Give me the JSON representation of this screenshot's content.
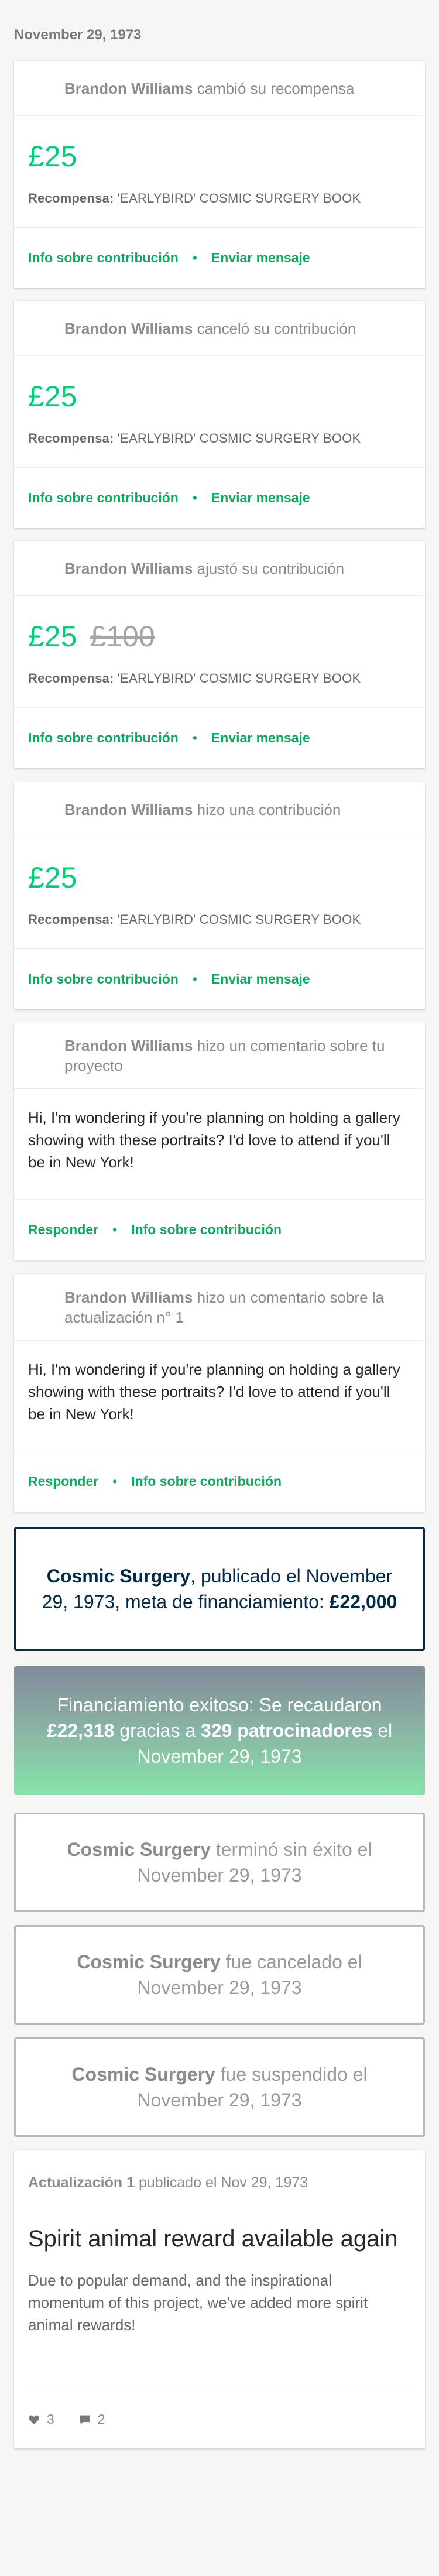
{
  "date_header": "November 29, 1973",
  "activity_cards": [
    {
      "user": "Brandon Williams",
      "action": "cambió su recompensa",
      "amount": "£25",
      "old_amount": "",
      "reward_label": "Recompensa:",
      "reward_name": "'EARLYBIRD' COSMIC SURGERY BOOK",
      "link1": "Info sobre contribución",
      "link2": "Enviar mensaje"
    },
    {
      "user": "Brandon Williams",
      "action": "canceló su contribución",
      "amount": "£25",
      "old_amount": "",
      "reward_label": "Recompensa:",
      "reward_name": "'EARLYBIRD' COSMIC SURGERY BOOK",
      "link1": "Info sobre contribución",
      "link2": "Enviar mensaje"
    },
    {
      "user": "Brandon Williams",
      "action": "ajustó su contribución",
      "amount": "£25",
      "old_amount": "£100",
      "reward_label": "Recompensa:",
      "reward_name": "'EARLYBIRD' COSMIC SURGERY BOOK",
      "link1": "Info sobre contribución",
      "link2": "Enviar mensaje"
    },
    {
      "user": "Brandon Williams",
      "action": "hizo una contribución",
      "amount": "£25",
      "old_amount": "",
      "reward_label": "Recompensa:",
      "reward_name": "'EARLYBIRD' COSMIC SURGERY BOOK",
      "link1": "Info sobre contribución",
      "link2": "Enviar mensaje"
    }
  ],
  "comment_cards": [
    {
      "user": "Brandon Williams",
      "action": "hizo un comentario sobre tu proyecto",
      "text": "Hi, I'm wondering if you're planning on holding a gallery showing with these portraits? I'd love to attend if you'll be in New York!",
      "link1": "Responder",
      "link2": "Info sobre contribución"
    },
    {
      "user": "Brandon Williams",
      "action": "hizo un comentario sobre la actualización n° 1",
      "text": "Hi, I'm wondering if you're planning on holding a gallery showing with these portraits? I'd love to attend if you'll be in New York!",
      "link1": "Responder",
      "link2": "Info sobre contribución"
    }
  ],
  "project_launched": {
    "project": "Cosmic Surgery",
    "text_a": ", publicado el November 29, 1973, meta de financiamiento: ",
    "goal": "£22,000"
  },
  "funding_success": {
    "text_a": "Financiamiento exitoso: Se recaudaron ",
    "raised": "£22,318",
    "text_b": " gracias a ",
    "backers": "329 patrocinadores",
    "text_c": " el November 29, 1973"
  },
  "status_boxes": [
    {
      "project": "Cosmic Surgery",
      "text": " terminó sin éxito el November 29, 1973"
    },
    {
      "project": "Cosmic Surgery",
      "text": " fue cancelado el November 29, 1973"
    },
    {
      "project": "Cosmic Surgery",
      "text": " fue suspendido el November 29, 1973"
    }
  ],
  "update": {
    "label": "Actualización 1",
    "published": " publicado el Nov 29, 1973",
    "title": "Spirit animal reward available again",
    "body": "Due to popular demand, and the inspirational momentum of this project, we've added more spirit animal rewards!",
    "likes": "3",
    "comments": "2",
    "like_icon": "heart-icon",
    "comment_icon": "comment-icon"
  },
  "colors": {
    "accent_green": "#05ce78",
    "link_green": "#0fa960",
    "navy": "#022a48"
  }
}
